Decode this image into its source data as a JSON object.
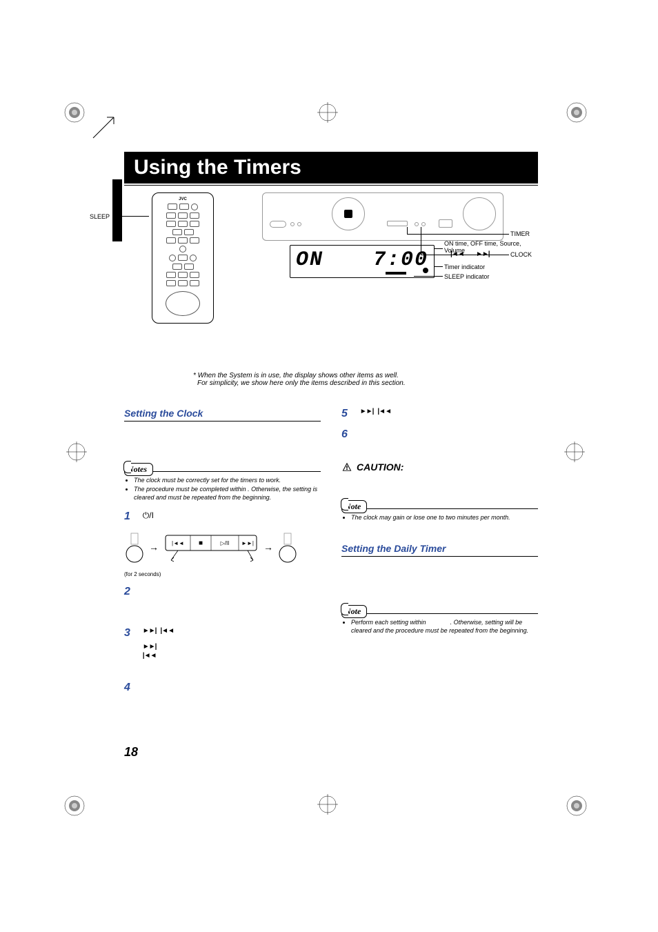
{
  "page_title": "Using the Timers",
  "remote_brand": "JVC",
  "remote_label": "SLEEP",
  "unit_labels": {
    "timer": "TIMER",
    "clock": "CLOCK",
    "prev": "|◄◄",
    "next": "►►|"
  },
  "lcd": {
    "left": "ON",
    "right": "7:00"
  },
  "lcd_callouts": {
    "top": "ON time, OFF time, Source, Volume",
    "timer_ind": "Timer indicator",
    "sleep_ind": "SLEEP indicator"
  },
  "footnote_line1": "* When the System is in use, the display shows other items as well.",
  "footnote_line2": "For simplicity, we show here only the items described in this section.",
  "left_col": {
    "heading": "Setting the Clock",
    "notes_label": "Notes",
    "notes": [
      "The clock must be correctly set for the timers to work.",
      "The procedure must be completed within                  . Otherwise, the setting is cleared and must be repeated from the beginning."
    ],
    "steps": {
      "s1": "1",
      "s1_icon": "⏻/I",
      "s2": "2",
      "s3": "3",
      "s3_icons_a": "►►|",
      "s3_icons_b": "|◄◄",
      "s3_icons_c": "►►|",
      "s3_icons_d": "|◄◄",
      "s4": "4"
    },
    "process_caption": "(for 2 seconds)"
  },
  "right_col": {
    "s5": "5",
    "s5_icons_a": "►►|",
    "s5_icons_b": "|◄◄",
    "s6": "6",
    "caution_label": "CAUTION:",
    "note_label": "Note",
    "note_text": "The clock may gain or lose one to two minutes per month.",
    "heading": "Setting the Daily Timer",
    "note2_label": "Note",
    "note2_text_a": "Perform each setting within ",
    "note2_text_b": ". Otherwise, setting will be cleared and the procedure must be repeated from the beginning."
  },
  "page_number": "18"
}
